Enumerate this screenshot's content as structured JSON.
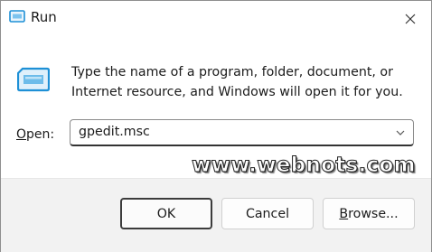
{
  "window": {
    "title": "Run",
    "icons": {
      "app": "run-icon",
      "close": "close-icon"
    }
  },
  "content": {
    "description": "Type the name of a program, folder, document, or Internet resource, and Windows will open it for you.",
    "icon": "run-icon"
  },
  "open_field": {
    "label_prefix": "",
    "label_underlined": "O",
    "label_rest": "pen:",
    "value": "gpedit.msc",
    "dropdown_icon": "chevron-down-icon"
  },
  "watermark": {
    "text": "www.webnots.com"
  },
  "buttons": {
    "ok": "OK",
    "cancel": "Cancel",
    "browse_underlined": "B",
    "browse_rest": "rowse..."
  },
  "colors": {
    "footer_bg": "#f2f2f2",
    "icon_blue": "#1e90d6"
  }
}
